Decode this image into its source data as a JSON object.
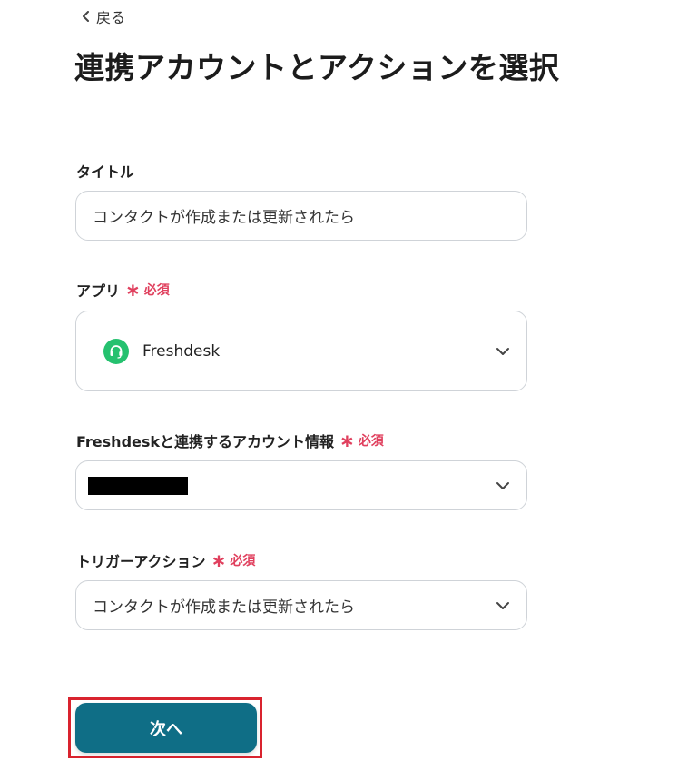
{
  "header": {
    "back_label": "戻る",
    "title": "連携アカウントとアクションを選択"
  },
  "required_label": "必須",
  "fields": {
    "title": {
      "label": "タイトル",
      "value": "コンタクトが作成または更新されたら"
    },
    "app": {
      "label": "アプリ",
      "value": "Freshdesk",
      "icon": "headset-icon",
      "icon_color": "#25c16f"
    },
    "account": {
      "label": "Freshdeskと連携するアカウント情報"
    },
    "trigger": {
      "label": "トリガーアクション",
      "value": "コンタクトが作成または更新されたら"
    }
  },
  "footer": {
    "next_label": "次へ",
    "next_color": "#0f6e86",
    "highlight_color": "#d9232e"
  }
}
